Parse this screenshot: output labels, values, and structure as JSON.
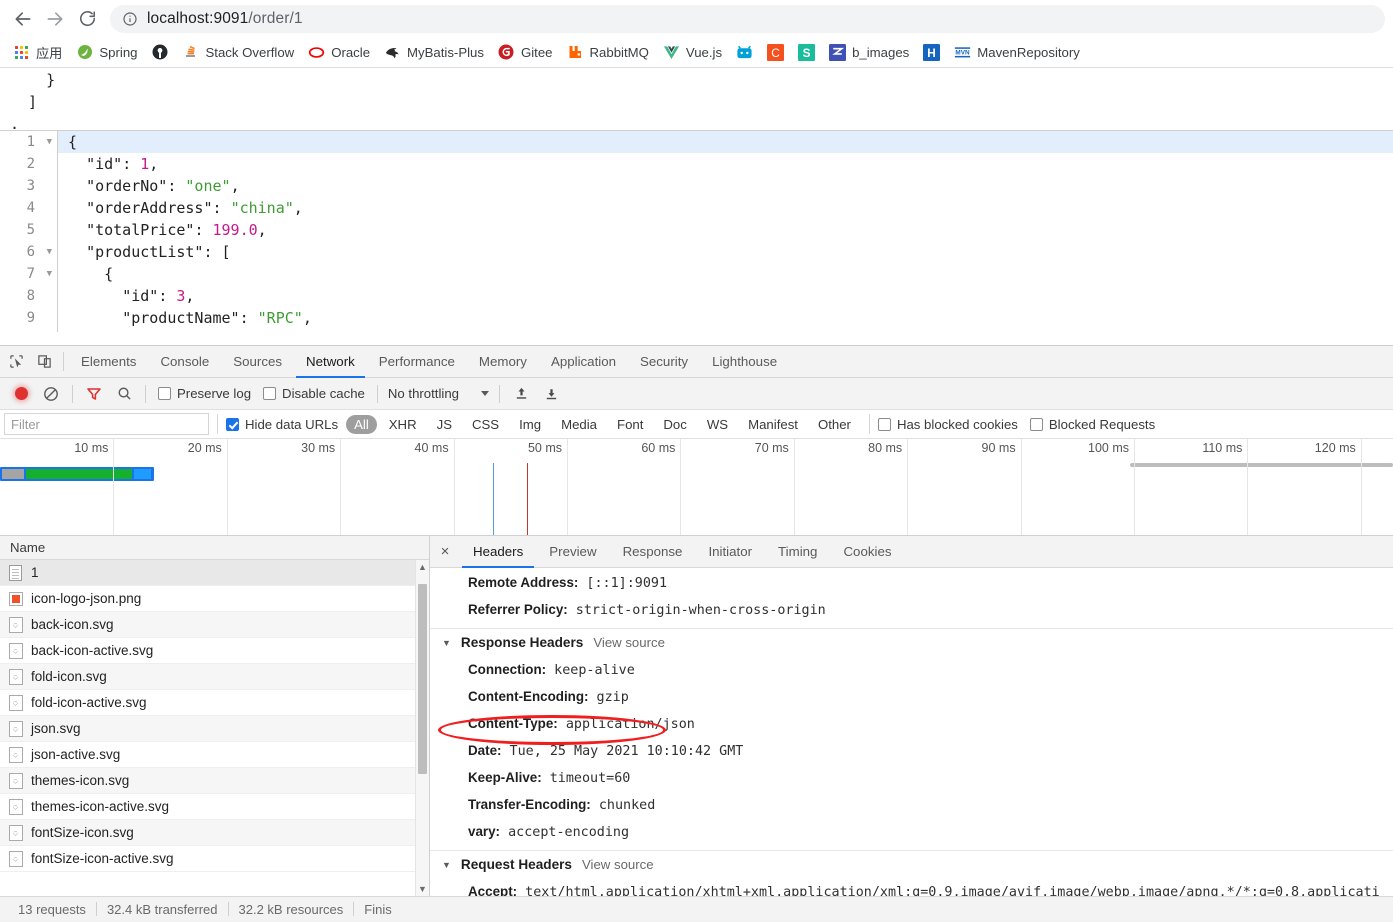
{
  "browser": {
    "back_label": "Back",
    "forward_label": "Forward",
    "reload_label": "Reload",
    "url_host": "localhost:9091",
    "url_path": "/order/1",
    "bookmarks": [
      {
        "label": "应用",
        "icon": "apps-grid-icon"
      },
      {
        "label": "Spring",
        "icon": "spring-leaf-icon",
        "color": "#6db33f"
      },
      {
        "label": "",
        "icon": "github-icon",
        "color": "#24292e"
      },
      {
        "label": "Stack Overflow",
        "icon": "stackoverflow-icon",
        "color": "#f48024"
      },
      {
        "label": "Oracle",
        "icon": "oracle-icon",
        "color": "#f80000"
      },
      {
        "label": "MyBatis-Plus",
        "icon": "mybatis-bird-icon",
        "color": "#2c2c2c"
      },
      {
        "label": "Gitee",
        "icon": "gitee-icon",
        "color": "#c71d23"
      },
      {
        "label": "RabbitMQ",
        "icon": "rabbitmq-icon",
        "color": "#f60"
      },
      {
        "label": "Vue.js",
        "icon": "vuejs-icon",
        "color": "#41b883"
      },
      {
        "label": "",
        "icon": "bilibili-icon",
        "color": "#00a1d6"
      },
      {
        "label": "",
        "icon": "c-letter-icon",
        "color": "#f4511e"
      },
      {
        "label": "",
        "icon": "s-letter-icon",
        "color": "#1abc9c"
      },
      {
        "label": "b_images",
        "icon": "blue-z-icon",
        "color": "#3f51b5"
      },
      {
        "label": "",
        "icon": "h-letter-icon",
        "color": "#1565c0"
      },
      {
        "label": "MavenRepository",
        "icon": "maven-icon",
        "color": "#1565c0"
      }
    ]
  },
  "page_content": {
    "tail_lines": [
      "    }",
      "  ]",
      "."
    ],
    "code_lines": [
      {
        "num": "1",
        "fold": true,
        "highlight": true,
        "html": "{"
      },
      {
        "num": "2",
        "fold": false,
        "highlight": false,
        "html": "  <span class=\"k\">\"id\"</span>: <span class=\"n\">1</span>,"
      },
      {
        "num": "3",
        "fold": false,
        "highlight": false,
        "html": "  <span class=\"k\">\"orderNo\"</span>: <span class=\"s\">\"one\"</span>,"
      },
      {
        "num": "4",
        "fold": false,
        "highlight": false,
        "html": "  <span class=\"k\">\"orderAddress\"</span>: <span class=\"s\">\"china\"</span>,"
      },
      {
        "num": "5",
        "fold": false,
        "highlight": false,
        "html": "  <span class=\"k\">\"totalPrice\"</span>: <span class=\"n\">199.0</span>,"
      },
      {
        "num": "6",
        "fold": true,
        "highlight": false,
        "html": "  <span class=\"k\">\"productList\"</span>: ["
      },
      {
        "num": "7",
        "fold": true,
        "highlight": false,
        "html": "    {"
      },
      {
        "num": "8",
        "fold": false,
        "highlight": false,
        "html": "      <span class=\"k\">\"id\"</span>: <span class=\"n\">3</span>,"
      },
      {
        "num": "9",
        "fold": false,
        "highlight": false,
        "html": "      <span class=\"k\">\"productName\"</span>: <span class=\"s\">\"RPC\"</span>,"
      }
    ],
    "json_values": {
      "id": 1,
      "orderNo": "one",
      "orderAddress": "china",
      "totalPrice": 199.0,
      "productList": [
        {
          "id": 3,
          "productName": "RPC"
        }
      ]
    }
  },
  "devtools": {
    "main_tabs": [
      {
        "label": "Elements",
        "active": false
      },
      {
        "label": "Console",
        "active": false
      },
      {
        "label": "Sources",
        "active": false
      },
      {
        "label": "Network",
        "active": true
      },
      {
        "label": "Performance",
        "active": false
      },
      {
        "label": "Memory",
        "active": false
      },
      {
        "label": "Application",
        "active": false
      },
      {
        "label": "Security",
        "active": false
      },
      {
        "label": "Lighthouse",
        "active": false
      }
    ],
    "toolbar": {
      "record_label": "Record",
      "clear_label": "Clear",
      "filter_label": "Filter",
      "search_label": "Search",
      "preserve_log_label": "Preserve log",
      "preserve_log_checked": false,
      "disable_cache_label": "Disable cache",
      "disable_cache_checked": false,
      "throttling_label": "No throttling",
      "import_label": "Import HAR",
      "export_label": "Export HAR"
    },
    "filterbar": {
      "filter_placeholder": "Filter",
      "filter_value": "",
      "hide_data_urls_label": "Hide data URLs",
      "hide_data_urls_checked": true,
      "types": [
        "All",
        "XHR",
        "JS",
        "CSS",
        "Img",
        "Media",
        "Font",
        "Doc",
        "WS",
        "Manifest",
        "Other"
      ],
      "active_type": "All",
      "has_blocked_cookies_label": "Has blocked cookies",
      "has_blocked_cookies_checked": false,
      "blocked_requests_label": "Blocked Requests",
      "blocked_requests_checked": false
    },
    "overview": {
      "ticks": [
        "10 ms",
        "20 ms",
        "30 ms",
        "40 ms",
        "50 ms",
        "60 ms",
        "70 ms",
        "80 ms",
        "90 ms",
        "100 ms",
        "110 ms",
        "120 ms"
      ]
    },
    "requests": {
      "column_name": "Name",
      "rows": [
        {
          "name": "1",
          "icon": "document-icon",
          "selected": true
        },
        {
          "name": "icon-logo-json.png",
          "icon": "image-icon",
          "selected": false
        },
        {
          "name": "back-icon.svg",
          "icon": "svg-icon",
          "selected": false
        },
        {
          "name": "back-icon-active.svg",
          "icon": "svg-icon",
          "selected": false
        },
        {
          "name": "fold-icon.svg",
          "icon": "svg-icon",
          "selected": false
        },
        {
          "name": "fold-icon-active.svg",
          "icon": "svg-icon",
          "selected": false
        },
        {
          "name": "json.svg",
          "icon": "svg-icon",
          "selected": false
        },
        {
          "name": "json-active.svg",
          "icon": "svg-icon",
          "selected": false
        },
        {
          "name": "themes-icon.svg",
          "icon": "svg-icon",
          "selected": false
        },
        {
          "name": "themes-icon-active.svg",
          "icon": "svg-icon",
          "selected": false
        },
        {
          "name": "fontSize-icon.svg",
          "icon": "svg-icon",
          "selected": false
        },
        {
          "name": "fontSize-icon-active.svg",
          "icon": "svg-icon",
          "selected": false
        }
      ]
    },
    "details": {
      "close_label": "×",
      "tabs": [
        {
          "label": "Headers",
          "active": true
        },
        {
          "label": "Preview",
          "active": false
        },
        {
          "label": "Response",
          "active": false
        },
        {
          "label": "Initiator",
          "active": false
        },
        {
          "label": "Timing",
          "active": false
        },
        {
          "label": "Cookies",
          "active": false
        }
      ],
      "general_rows": [
        {
          "name": "Remote Address:",
          "value": "[::1]:9091"
        },
        {
          "name": "Referrer Policy:",
          "value": "strict-origin-when-cross-origin"
        }
      ],
      "response_headers_title": "Response Headers",
      "view_source_label": "View source",
      "response_headers": [
        {
          "name": "Connection:",
          "value": "keep-alive",
          "highlighted": false
        },
        {
          "name": "Content-Encoding:",
          "value": "gzip",
          "highlighted": true
        },
        {
          "name": "Content-Type:",
          "value": "application/json",
          "highlighted": false
        },
        {
          "name": "Date:",
          "value": "Tue, 25 May 2021 10:10:42 GMT",
          "highlighted": false
        },
        {
          "name": "Keep-Alive:",
          "value": "timeout=60",
          "highlighted": false
        },
        {
          "name": "Transfer-Encoding:",
          "value": "chunked",
          "highlighted": false
        },
        {
          "name": "vary:",
          "value": "accept-encoding",
          "highlighted": false
        }
      ],
      "request_headers_title": "Request Headers",
      "request_headers": [
        {
          "name": "Accept:",
          "value": "text/html,application/xhtml+xml,application/xml;q=0.9,image/avif,image/webp,image/apng,*/*;q=0.8,applicati"
        }
      ]
    },
    "statusbar": {
      "requests": "13 requests",
      "transferred": "32.4 kB transferred",
      "resources": "32.2 kB resources",
      "finish": "Finis"
    },
    "annotation_color": "#f01e1e"
  }
}
